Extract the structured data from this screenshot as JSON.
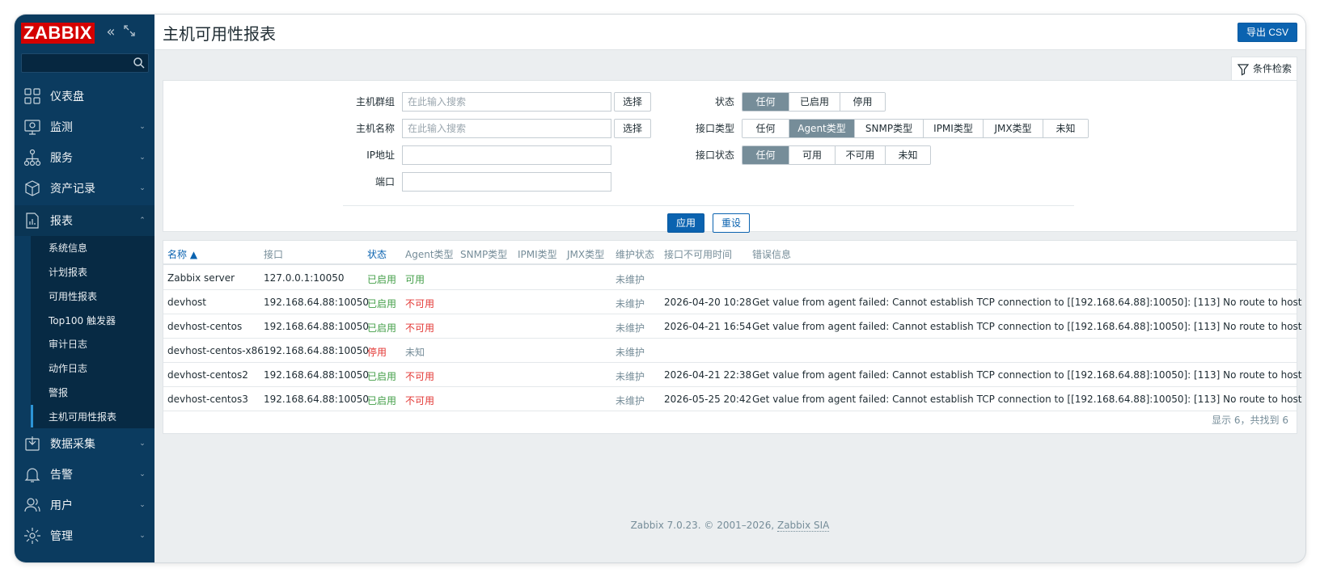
{
  "app": {
    "brand": "ZABBIX",
    "page_title": "主机可用性报表",
    "export_label": "导出 CSV",
    "filter_tab_label": "条件检索"
  },
  "sidebar": {
    "items": [
      {
        "label": "仪表盘",
        "icon": "dashboard-icon",
        "has_chevron": false
      },
      {
        "label": "监测",
        "icon": "monitoring-icon",
        "has_chevron": true
      },
      {
        "label": "服务",
        "icon": "services-icon",
        "has_chevron": true
      },
      {
        "label": "资产记录",
        "icon": "inventory-icon",
        "has_chevron": true
      },
      {
        "label": "报表",
        "icon": "reports-icon",
        "has_chevron": true,
        "expanded": true
      },
      {
        "label": "数据采集",
        "icon": "data-collection-icon",
        "has_chevron": true
      },
      {
        "label": "告警",
        "icon": "alerts-icon",
        "has_chevron": true
      },
      {
        "label": "用户",
        "icon": "users-icon",
        "has_chevron": true
      },
      {
        "label": "管理",
        "icon": "administration-icon",
        "has_chevron": true
      }
    ],
    "sub_items": [
      {
        "label": "系统信息"
      },
      {
        "label": "计划报表"
      },
      {
        "label": "可用性报表"
      },
      {
        "label": "Top100 触发器"
      },
      {
        "label": "审计日志"
      },
      {
        "label": "动作日志"
      },
      {
        "label": "警报"
      },
      {
        "label": "主机可用性报表",
        "selected": true
      }
    ]
  },
  "filter": {
    "host_group_label": "主机群组",
    "host_group_placeholder": "在此输入搜索",
    "host_name_label": "主机名称",
    "host_name_placeholder": "在此输入搜索",
    "select_label": "选择",
    "ip_label": "IP地址",
    "port_label": "端口",
    "status_label": "状态",
    "status_options": [
      "任何",
      "已启用",
      "停用"
    ],
    "status_selected": "任何",
    "interface_type_label": "接口类型",
    "interface_type_options": [
      "任何",
      "Agent类型",
      "SNMP类型",
      "IPMI类型",
      "JMX类型",
      "未知"
    ],
    "interface_type_selected": "Agent类型",
    "interface_status_label": "接口状态",
    "interface_status_options": [
      "任何",
      "可用",
      "不可用",
      "未知"
    ],
    "interface_status_selected": "任何",
    "apply_label": "应用",
    "reset_label": "重设"
  },
  "table": {
    "columns": [
      "名称 ▲",
      "接口",
      "状态",
      "Agent类型",
      "SNMP类型",
      "IPMI类型",
      "JMX类型",
      "维护状态",
      "接口不可用时间",
      "错误信息"
    ],
    "rows": [
      {
        "name": "Zabbix server",
        "interface": "127.0.0.1:10050",
        "status": "已启用",
        "agent": "可用",
        "maintenance": "未维护",
        "down_since": "",
        "error": ""
      },
      {
        "name": "devhost",
        "interface": "192.168.64.88:10050",
        "status": "已启用",
        "agent": "不可用",
        "maintenance": "未维护",
        "down_since": "2026-04-20 10:28",
        "error": "Get value from agent failed: Cannot establish TCP connection to [[192.168.64.88]:10050]: [113] No route to host"
      },
      {
        "name": "devhost-centos",
        "interface": "192.168.64.88:10050",
        "status": "已启用",
        "agent": "不可用",
        "maintenance": "未维护",
        "down_since": "2026-04-21 16:54",
        "error": "Get value from agent failed: Cannot establish TCP connection to [[192.168.64.88]:10050]: [113] No route to host"
      },
      {
        "name": "devhost-centos-x86",
        "interface": "192.168.64.88:10050",
        "status": "停用",
        "agent": "未知",
        "maintenance": "未维护",
        "down_since": "",
        "error": ""
      },
      {
        "name": "devhost-centos2",
        "interface": "192.168.64.88:10050",
        "status": "已启用",
        "agent": "不可用",
        "maintenance": "未维护",
        "down_since": "2026-04-21 22:38",
        "error": "Get value from agent failed: Cannot establish TCP connection to [[192.168.64.88]:10050]: [113] No route to host"
      },
      {
        "name": "devhost-centos3",
        "interface": "192.168.64.88:10050",
        "status": "已启用",
        "agent": "不可用",
        "maintenance": "未维护",
        "down_since": "2026-05-25 20:42",
        "error": "Get value from agent failed: Cannot establish TCP connection to [[192.168.64.88]:10050]: [113] No route to host"
      }
    ],
    "count_text": "显示 6，共找到 6"
  },
  "footer": {
    "text": "Zabbix 7.0.23. © 2001–2026, ",
    "link": "Zabbix SIA"
  },
  "colors": {
    "sidebar_bg": "#0b3b5f",
    "brand_red": "#d40000",
    "primary_blue": "#0b63b0",
    "status_green": "#429e47",
    "status_red": "#e33734",
    "segment_on": "#768d99"
  }
}
